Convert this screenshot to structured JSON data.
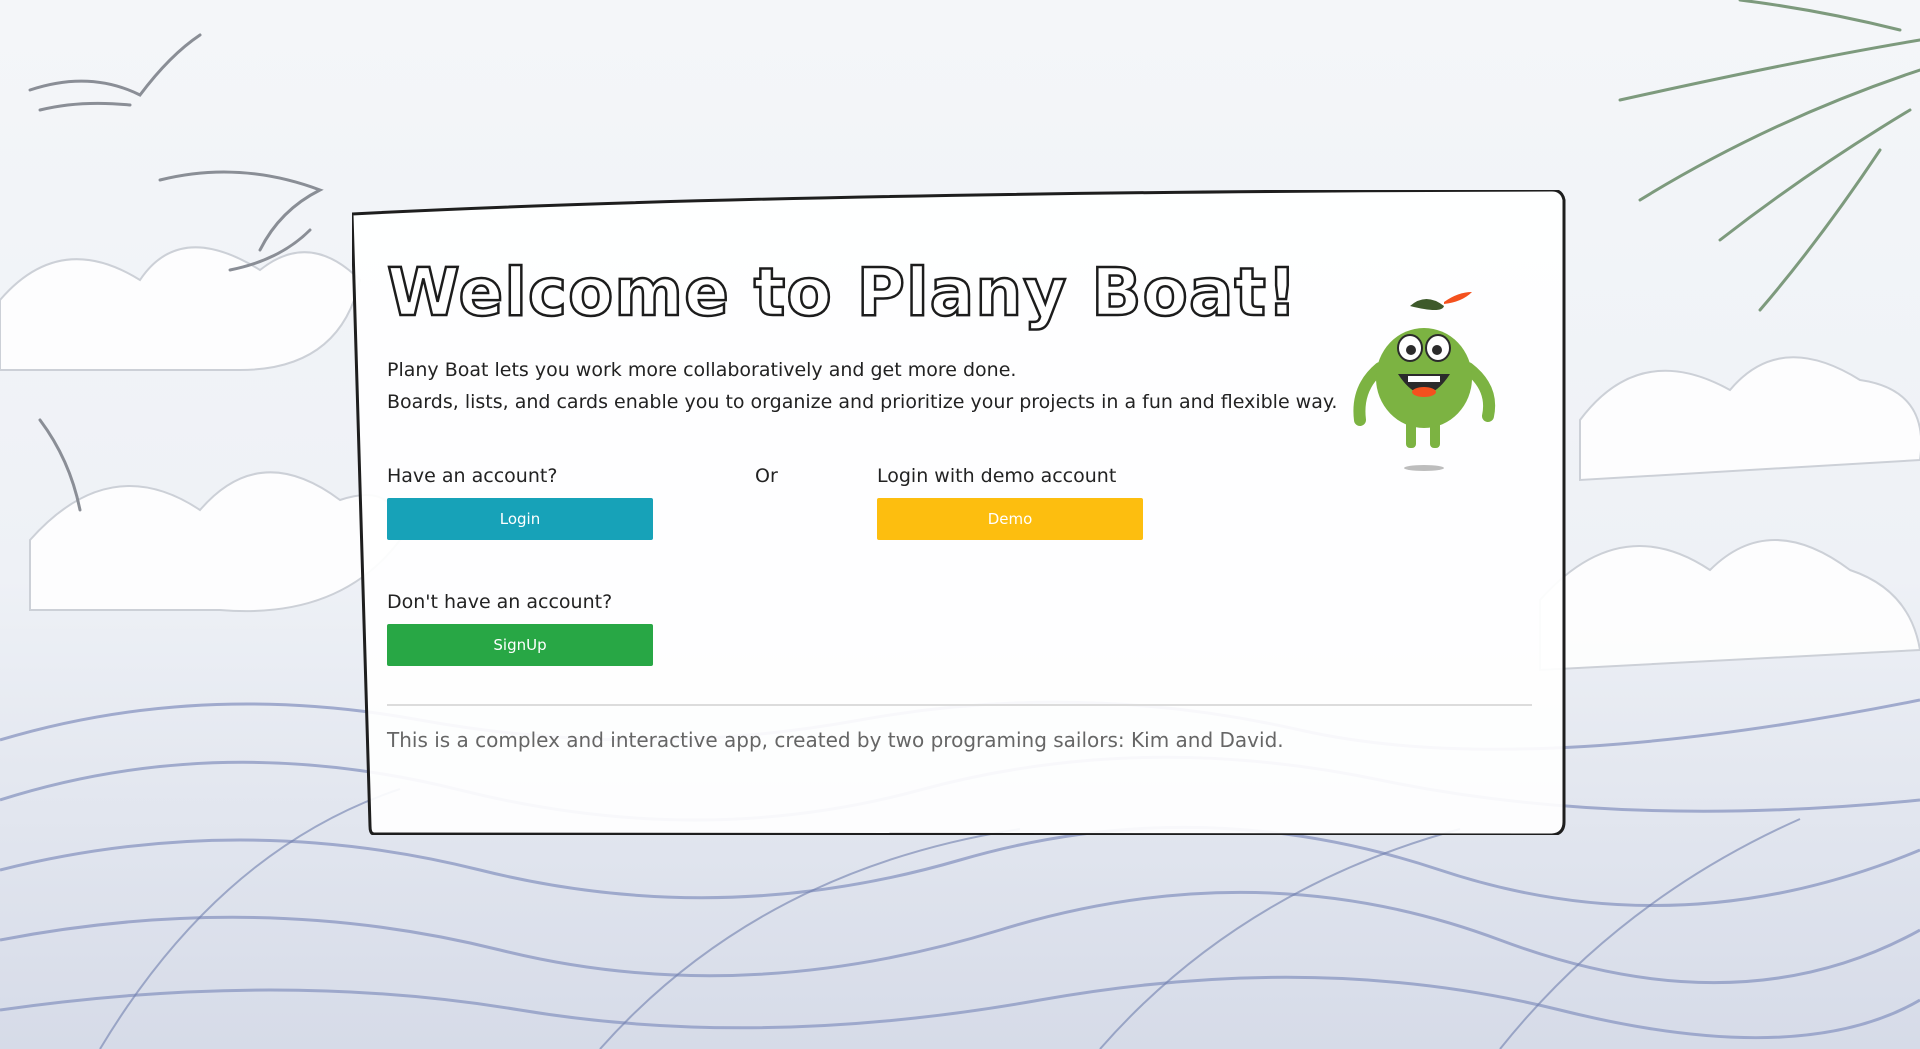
{
  "page": {
    "title": "Welcome to Plany Boat!",
    "intro_line_1": "Plany Boat lets you work more collaboratively and get more done.",
    "intro_line_2": "Boards, lists, and cards enable you to organize and prioritize your projects in a fun and flexible way."
  },
  "auth": {
    "have_account_label": "Have an account?",
    "login_button": "Login",
    "or_label": "Or",
    "demo_label": "Login with demo account",
    "demo_button": "Demo",
    "no_account_label": "Don't have an account?",
    "signup_button": "SignUp"
  },
  "footer": {
    "note": "This is a complex and interactive app, created by two programing sailors: Kim and David."
  },
  "colors": {
    "login": "#17a2b8",
    "demo": "#fdbe0f",
    "signup": "#28a745",
    "mascot_body": "#7cb342",
    "mascot_hat_feather": "#f4511e"
  },
  "icons": {
    "mascot": "green-monster-mascot"
  }
}
